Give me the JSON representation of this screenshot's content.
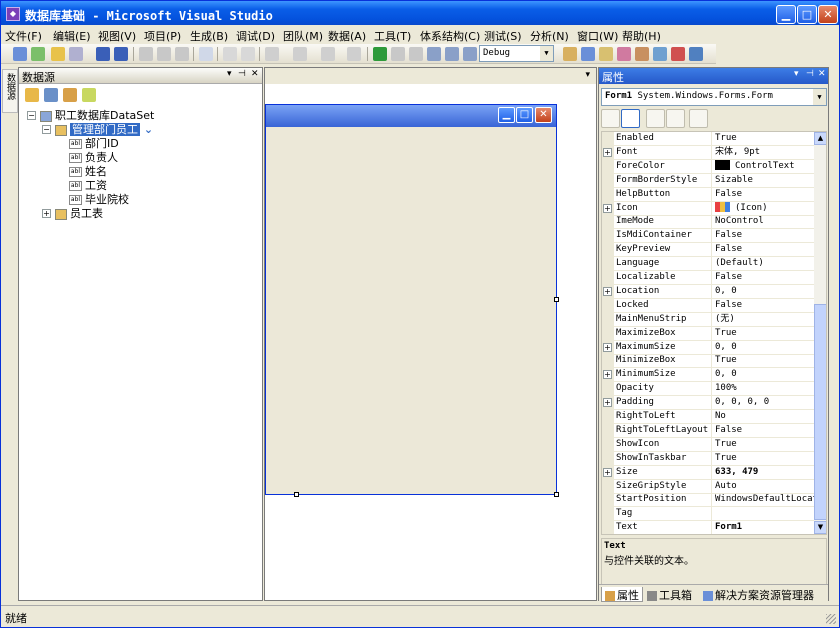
{
  "window": {
    "title": "数据库基础 - Microsoft Visual Studio"
  },
  "menu": [
    "文件(F)",
    "编辑(E)",
    "视图(V)",
    "项目(P)",
    "生成(B)",
    "调试(D)",
    "团队(M)",
    "数据(A)",
    "工具(T)",
    "体系结构(C)",
    "测试(S)",
    "分析(N)",
    "窗口(W)",
    "帮助(H)"
  ],
  "toolbar": {
    "config_value": "Debug"
  },
  "side_tab": "数据源",
  "datasource": {
    "title": "数据源",
    "pin_label": "▾ ⊣ ✕",
    "tree": [
      {
        "label": "职工数据库DataSet",
        "level": 0,
        "expanded": true,
        "icon": "dataset-icon"
      },
      {
        "label": "管理部门员工",
        "level": 1,
        "expanded": true,
        "icon": "table-icon",
        "selected": true
      },
      {
        "label": "部门ID",
        "level": 2,
        "icon": "textbox-icon"
      },
      {
        "label": "负责人",
        "level": 2,
        "icon": "textbox-icon"
      },
      {
        "label": "姓名",
        "level": 2,
        "icon": "textbox-icon"
      },
      {
        "label": "工资",
        "level": 2,
        "icon": "textbox-icon"
      },
      {
        "label": "毕业院校",
        "level": 2,
        "icon": "textbox-icon"
      },
      {
        "label": "员工表",
        "level": 1,
        "expanded": false,
        "icon": "table-icon"
      }
    ]
  },
  "properties": {
    "title": "属性",
    "object_name": "Form1",
    "object_type": "System.Windows.Forms.Form",
    "rows": [
      {
        "name": "Enabled",
        "value": "True"
      },
      {
        "name": "Font",
        "value": "宋体, 9pt",
        "expandable": true
      },
      {
        "name": "ForeColor",
        "value": "ControlText",
        "swatch": "#000000"
      },
      {
        "name": "FormBorderStyle",
        "value": "Sizable"
      },
      {
        "name": "HelpButton",
        "value": "False"
      },
      {
        "name": "Icon",
        "value": "(Icon)",
        "expandable": true,
        "swatch": "icon"
      },
      {
        "name": "ImeMode",
        "value": "NoControl"
      },
      {
        "name": "IsMdiContainer",
        "value": "False"
      },
      {
        "name": "KeyPreview",
        "value": "False"
      },
      {
        "name": "Language",
        "value": "(Default)"
      },
      {
        "name": "Localizable",
        "value": "False"
      },
      {
        "name": "Location",
        "value": "0, 0",
        "expandable": true
      },
      {
        "name": "Locked",
        "value": "False"
      },
      {
        "name": "MainMenuStrip",
        "value": "(无)"
      },
      {
        "name": "MaximizeBox",
        "value": "True"
      },
      {
        "name": "MaximumSize",
        "value": "0, 0",
        "expandable": true
      },
      {
        "name": "MinimizeBox",
        "value": "True"
      },
      {
        "name": "MinimumSize",
        "value": "0, 0",
        "expandable": true
      },
      {
        "name": "Opacity",
        "value": "100%"
      },
      {
        "name": "Padding",
        "value": "0, 0, 0, 0",
        "expandable": true
      },
      {
        "name": "RightToLeft",
        "value": "No"
      },
      {
        "name": "RightToLeftLayout",
        "value": "False"
      },
      {
        "name": "ShowIcon",
        "value": "True"
      },
      {
        "name": "ShowInTaskbar",
        "value": "True"
      },
      {
        "name": "Size",
        "value": "633, 479",
        "expandable": true,
        "bold": true
      },
      {
        "name": "SizeGripStyle",
        "value": "Auto"
      },
      {
        "name": "StartPosition",
        "value": "WindowsDefaultLocation"
      },
      {
        "name": "Tag",
        "value": ""
      },
      {
        "name": "Text",
        "value": "Form1",
        "bold": true
      }
    ],
    "description_title": "Text",
    "description_text": "与控件关联的文本。",
    "tabs": [
      "属性",
      "工具箱",
      "解决方案资源管理器"
    ]
  },
  "status": {
    "text": "就绪"
  }
}
